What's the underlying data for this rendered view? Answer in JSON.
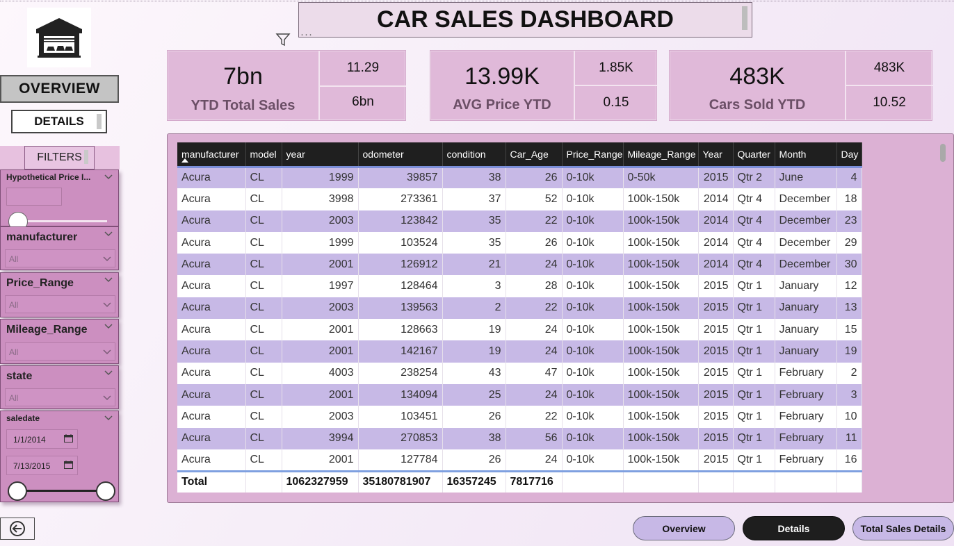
{
  "title": "CAR SALES DASHBOARD",
  "nav": {
    "overview": "OVERVIEW",
    "details": "DETAILS",
    "filters": "FILTERS"
  },
  "slicers": {
    "hypothetical": {
      "title": "Hypothetical Price I..."
    },
    "manufacturer": {
      "title": "manufacturer",
      "value": "All"
    },
    "price_range": {
      "title": "Price_Range",
      "value": "All"
    },
    "mileage_range": {
      "title": "Mileage_Range",
      "value": "All"
    },
    "state": {
      "title": "state",
      "value": "All"
    },
    "saledate": {
      "title": "saledate",
      "start": "1/1/2014",
      "end": "7/13/2015"
    }
  },
  "kpis": {
    "sales": {
      "value": "7bn",
      "label": "YTD Total Sales",
      "top": "11.29",
      "bottom": "6bn"
    },
    "price": {
      "value": "13.99K",
      "label": "AVG Price YTD",
      "top": "1.85K",
      "bottom": "0.15"
    },
    "cars": {
      "value": "483K",
      "label": "Cars Sold YTD",
      "top": "483K",
      "bottom": "10.52"
    }
  },
  "table": {
    "columns": [
      "manufacturer",
      "model",
      "year",
      "odometer",
      "condition",
      "Car_Age",
      "Price_Range",
      "Mileage_Range",
      "Year",
      "Quarter",
      "Month",
      "Day"
    ],
    "rows": [
      [
        "Acura",
        "CL",
        "1999",
        "39857",
        "38",
        "26",
        "0-10k",
        "0-50k",
        "2015",
        "Qtr 2",
        "June",
        "4"
      ],
      [
        "Acura",
        "CL",
        "3998",
        "273361",
        "37",
        "52",
        "0-10k",
        "100k-150k",
        "2014",
        "Qtr 4",
        "December",
        "18"
      ],
      [
        "Acura",
        "CL",
        "2003",
        "123842",
        "35",
        "22",
        "0-10k",
        "100k-150k",
        "2014",
        "Qtr 4",
        "December",
        "23"
      ],
      [
        "Acura",
        "CL",
        "1999",
        "103524",
        "35",
        "26",
        "0-10k",
        "100k-150k",
        "2014",
        "Qtr 4",
        "December",
        "29"
      ],
      [
        "Acura",
        "CL",
        "2001",
        "126912",
        "21",
        "24",
        "0-10k",
        "100k-150k",
        "2014",
        "Qtr 4",
        "December",
        "30"
      ],
      [
        "Acura",
        "CL",
        "1997",
        "128464",
        "3",
        "28",
        "0-10k",
        "100k-150k",
        "2015",
        "Qtr 1",
        "January",
        "12"
      ],
      [
        "Acura",
        "CL",
        "2003",
        "139563",
        "2",
        "22",
        "0-10k",
        "100k-150k",
        "2015",
        "Qtr 1",
        "January",
        "13"
      ],
      [
        "Acura",
        "CL",
        "2001",
        "128663",
        "19",
        "24",
        "0-10k",
        "100k-150k",
        "2015",
        "Qtr 1",
        "January",
        "15"
      ],
      [
        "Acura",
        "CL",
        "2001",
        "142167",
        "19",
        "24",
        "0-10k",
        "100k-150k",
        "2015",
        "Qtr 1",
        "January",
        "19"
      ],
      [
        "Acura",
        "CL",
        "4003",
        "238254",
        "43",
        "47",
        "0-10k",
        "100k-150k",
        "2015",
        "Qtr 1",
        "February",
        "2"
      ],
      [
        "Acura",
        "CL",
        "2001",
        "134094",
        "25",
        "24",
        "0-10k",
        "100k-150k",
        "2015",
        "Qtr 1",
        "February",
        "3"
      ],
      [
        "Acura",
        "CL",
        "2003",
        "103451",
        "26",
        "22",
        "0-10k",
        "100k-150k",
        "2015",
        "Qtr 1",
        "February",
        "10"
      ],
      [
        "Acura",
        "CL",
        "3994",
        "270853",
        "38",
        "56",
        "0-10k",
        "100k-150k",
        "2015",
        "Qtr 1",
        "February",
        "11"
      ],
      [
        "Acura",
        "CL",
        "2001",
        "127784",
        "26",
        "24",
        "0-10k",
        "100k-150k",
        "2015",
        "Qtr 1",
        "February",
        "16"
      ]
    ],
    "total": [
      "Total",
      "",
      "1062327959",
      "35180781907",
      "16357245",
      "7817716",
      "",
      "",
      "",
      "",
      "",
      ""
    ]
  },
  "bottom_nav": {
    "overview": "Overview",
    "details": "Details",
    "total_sales_details": "Total Sales Details"
  },
  "colors": {
    "accent_pink": "#cc8fc0",
    "row_lavender": "#c7b9e6",
    "header_dark": "#1f1f1f"
  }
}
